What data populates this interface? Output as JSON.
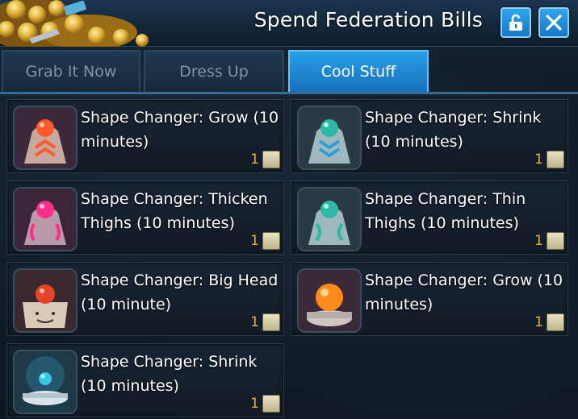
{
  "window": {
    "title": "Spend Federation Bills",
    "lock_button_icon": "unlock-icon",
    "close_button_icon": "close-icon"
  },
  "tabs": [
    {
      "label": "Grab It Now",
      "active": false
    },
    {
      "label": "Dress Up",
      "active": false
    },
    {
      "label": "Cool Stuff",
      "active": true
    }
  ],
  "items": [
    {
      "name": "Shape Changer: Grow (10 minutes)",
      "price": "1",
      "icon": "grow-orb-icon",
      "accent": "#ff5a2a"
    },
    {
      "name": "Shape Changer: Shrink (10 minutes)",
      "price": "1",
      "icon": "shrink-orb-icon",
      "accent": "#2fb7a8"
    },
    {
      "name": "Shape Changer: Thicken Thighs (10 minutes)",
      "price": "1",
      "icon": "thicken-thighs-orb-icon",
      "accent": "#ff2d8a"
    },
    {
      "name": "Shape Changer: Thin Thighs (10 minutes)",
      "price": "1",
      "icon": "thin-thighs-orb-icon",
      "accent": "#2fb7a8"
    },
    {
      "name": "Shape Changer: Big Head (10 minute)",
      "price": "1",
      "icon": "big-head-orb-icon",
      "accent": "#e4452a"
    },
    {
      "name": "Shape Changer: Grow (10 minutes)",
      "price": "1",
      "icon": "grow-orb-icon",
      "accent": "#ff8a1a"
    },
    {
      "name": "Shape Changer: Shrink (10 minutes)",
      "price": "1",
      "icon": "shrink-orb-icon",
      "accent": "#38c6e6"
    }
  ],
  "currency_icon": "federation-bill-icon"
}
